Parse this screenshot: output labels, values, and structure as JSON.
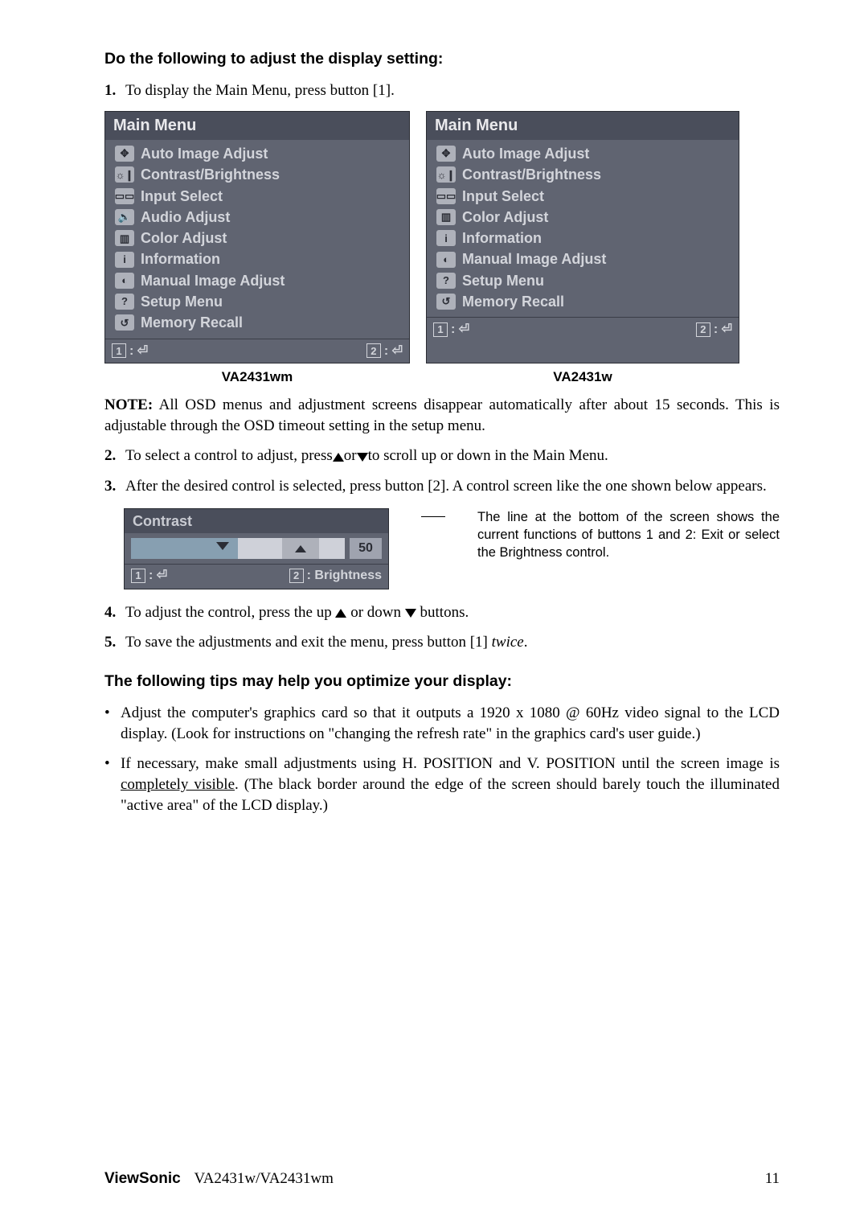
{
  "heading1": "Do the following to adjust the display setting:",
  "step1_num": "1.",
  "step1": "To display the Main Menu, press button [1].",
  "menuTitle": "Main Menu",
  "leftMenu": [
    {
      "icon": "✥",
      "label": "Auto Image Adjust"
    },
    {
      "icon": "☼❙",
      "label": "Contrast/Brightness"
    },
    {
      "icon": "▭▭",
      "label": "Input Select"
    },
    {
      "icon": "🔊",
      "label": "Audio Adjust"
    },
    {
      "icon": "▥",
      "label": "Color Adjust"
    },
    {
      "icon": "i",
      "label": "Information"
    },
    {
      "icon": "◐",
      "label": "Manual Image Adjust"
    },
    {
      "icon": "?",
      "label": "Setup Menu"
    },
    {
      "icon": "↺",
      "label": "Memory Recall"
    }
  ],
  "rightMenu": [
    {
      "icon": "✥",
      "label": "Auto Image Adjust"
    },
    {
      "icon": "☼❙",
      "label": "Contrast/Brightness"
    },
    {
      "icon": "▭▭",
      "label": "Input Select"
    },
    {
      "icon": "▥",
      "label": "Color Adjust"
    },
    {
      "icon": "i",
      "label": "Information"
    },
    {
      "icon": "◐",
      "label": "Manual Image Adjust"
    },
    {
      "icon": "?",
      "label": "Setup Menu"
    },
    {
      "icon": "↺",
      "label": "Memory Recall"
    }
  ],
  "footerKey1": "1",
  "footerKey2": "2",
  "captionLeft": "VA2431wm",
  "captionRight": "VA2431w",
  "noteLabel": "NOTE:",
  "noteText": " All OSD menus and adjustment screens disappear automatically after about 15 seconds. This is adjustable through the OSD timeout setting in the setup menu.",
  "step2_num": "2.",
  "step2a": "To select a control to adjust, press",
  "step2b": "or",
  "step2c": "to scroll up or down in the Main Menu.",
  "step3_num": "3.",
  "step3": "After the desired control is selected, press button [2]. A control screen like the one shown below appears.",
  "contrastTitle": "Contrast",
  "contrastValue": "50",
  "contrastFooterKey1": "1",
  "contrastFooterKey2": "2",
  "contrastFooterLabel": ": Brightness",
  "sideNote": "The line at the bottom of the screen shows the current functions of buttons 1 and 2: Exit or select the Brightness control.",
  "step4_num": "4.",
  "step4a": "To adjust the control, press the up ",
  "step4b": " or down ",
  "step4c": " buttons.",
  "step5_num": "5.",
  "step5a": "To save the adjustments and exit the menu, press button [1] ",
  "step5_twice": "twice",
  "step5_dot": ".",
  "heading2": "The following tips may help you optimize your display:",
  "tip1": "Adjust the computer's graphics card so that it outputs a 1920 x 1080 @ 60Hz video signal to the LCD display. (Look for instructions on \"changing the refresh rate\" in the graphics card's user guide.)",
  "tip2a": "If necessary, make small adjustments using H. POSITION and V. POSITION until the screen image is ",
  "tip2_underline": "completely visible",
  "tip2b": ". (The black border around the edge of the screen should barely touch the illuminated \"active area\" of the LCD display.)",
  "footerBrand": "ViewSonic",
  "footerModel": "VA2431w/VA2431wm",
  "pageNum": "11"
}
